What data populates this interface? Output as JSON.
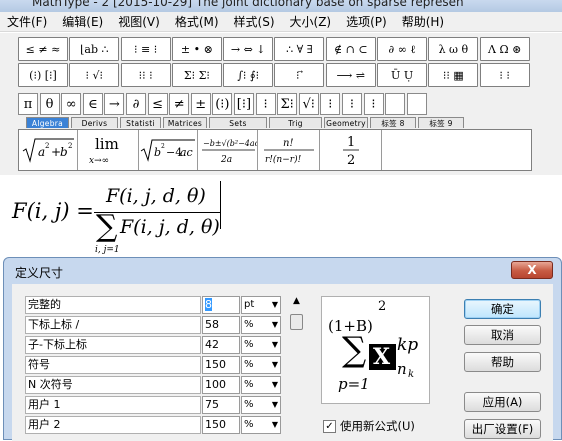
{
  "window": {
    "title": "MathType - 2 [2015-10-29] The joint dictionary base on sparse represen"
  },
  "menu": {
    "items": [
      "文件(F)",
      "编辑(E)",
      "视图(V)",
      "格式(M)",
      "样式(S)",
      "大小(Z)",
      "选项(P)",
      "帮助(H)"
    ]
  },
  "toolbar": {
    "template_row1": [
      "≤ ≠ ≈",
      "⌊ab ∴",
      "⁝ ≡ ⁝",
      "± • ⊗",
      "→ ⇔ ↓",
      "∴ ∀ ∃",
      "∉ ∩ ⊂",
      "∂ ∞ ℓ",
      "λ ω θ",
      "Λ Ω ⊛"
    ],
    "template_row2": [
      "(⁝) [⁝]",
      "⁝ √⁝",
      "⁝⁝ ⁝",
      "Σ⁝ Σ⁝",
      "∫⁝ ∮⁝",
      "⁝ ⃗",
      "⟶ ⇌",
      "Ū Ụ",
      "⁝⁝ ▦",
      "⁝ ⁝"
    ],
    "symbol_row": [
      "π",
      "θ",
      "∞",
      "∈",
      "→",
      "∂",
      "≤",
      "≠",
      "±",
      "(⁝)",
      "[⁝]",
      "⁝",
      "Σ⁝",
      "√⁝",
      "⁝",
      "⁝",
      "⁝",
      "",
      ""
    ],
    "tabs": [
      "Algebra",
      "Derivs",
      "Statisti",
      "Matrices",
      "Sets",
      "Trig",
      "Geometry",
      "标签 8",
      "标签 9"
    ],
    "active_tab": "Algebra",
    "expressions": [
      "√(a²+b²)",
      "lim x→∞",
      "√(b²−4ac)",
      "−b±√(b²−4ac) / 2a",
      "n! / r!(n−r)!",
      "1/2"
    ]
  },
  "document": {
    "lhs": "F(i, j) =",
    "numerator": "F(i, j, d, θ)",
    "denominator_sum": "∑",
    "denominator_expr": "F(i, j, d, θ)",
    "sum_limits": "i, j=1"
  },
  "dialog": {
    "title": "定义尺寸",
    "close_label": "X",
    "rows": [
      {
        "label": "完整的",
        "value": "8",
        "unit": "pt"
      },
      {
        "label": "下标上标 /",
        "value": "58",
        "unit": "%"
      },
      {
        "label": "子-下标上标",
        "value": "42",
        "unit": "%"
      },
      {
        "label": "符号",
        "value": "150",
        "unit": "%"
      },
      {
        "label": "N 次符号",
        "value": "100",
        "unit": "%"
      },
      {
        "label": "用户 1",
        "value": "75",
        "unit": "%"
      },
      {
        "label": "用户 2",
        "value": "150",
        "unit": "%"
      }
    ],
    "preview": {
      "base": "(1+B)",
      "power": "2",
      "sum_lower": "p=1",
      "box_letter": "X",
      "sup": "kp",
      "sub": "n",
      "subsub": "k"
    },
    "checkbox_label": "使用新公式(U)",
    "checkbox_checked": true,
    "buttons": {
      "ok": "确定",
      "cancel": "取消",
      "help": "帮助",
      "apply": "应用(A)",
      "factory": "出厂设置(F)"
    }
  }
}
